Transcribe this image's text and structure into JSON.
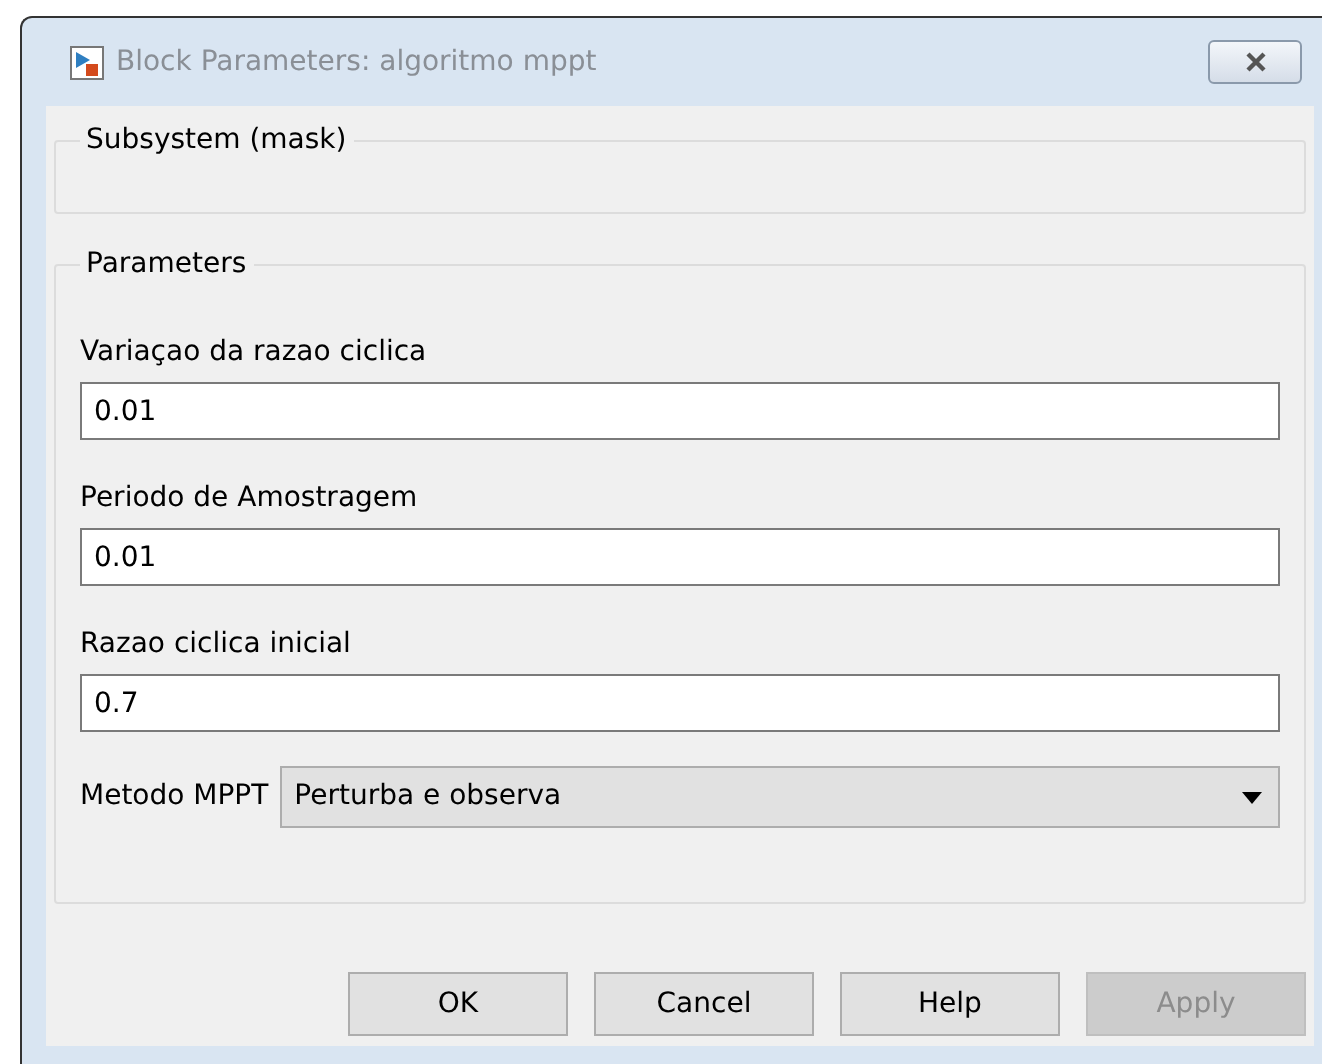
{
  "window": {
    "title": "Block Parameters: algoritmo mppt"
  },
  "description_group": {
    "title": "Subsystem (mask)"
  },
  "parameters_group": {
    "title": "Parameters",
    "fields": [
      {
        "label": "Variaçao da razao ciclica",
        "value": "0.01"
      },
      {
        "label": "Periodo de Amostragem",
        "value": "0.01"
      },
      {
        "label": "Razao ciclica inicial",
        "value": "0.7"
      }
    ],
    "dropdown": {
      "label": "Metodo MPPT",
      "value": "Perturba e observa"
    }
  },
  "buttons": [
    {
      "label": "OK",
      "disabled": false
    },
    {
      "label": "Cancel",
      "disabled": false
    },
    {
      "label": "Help",
      "disabled": false
    },
    {
      "label": "Apply",
      "disabled": true
    }
  ]
}
